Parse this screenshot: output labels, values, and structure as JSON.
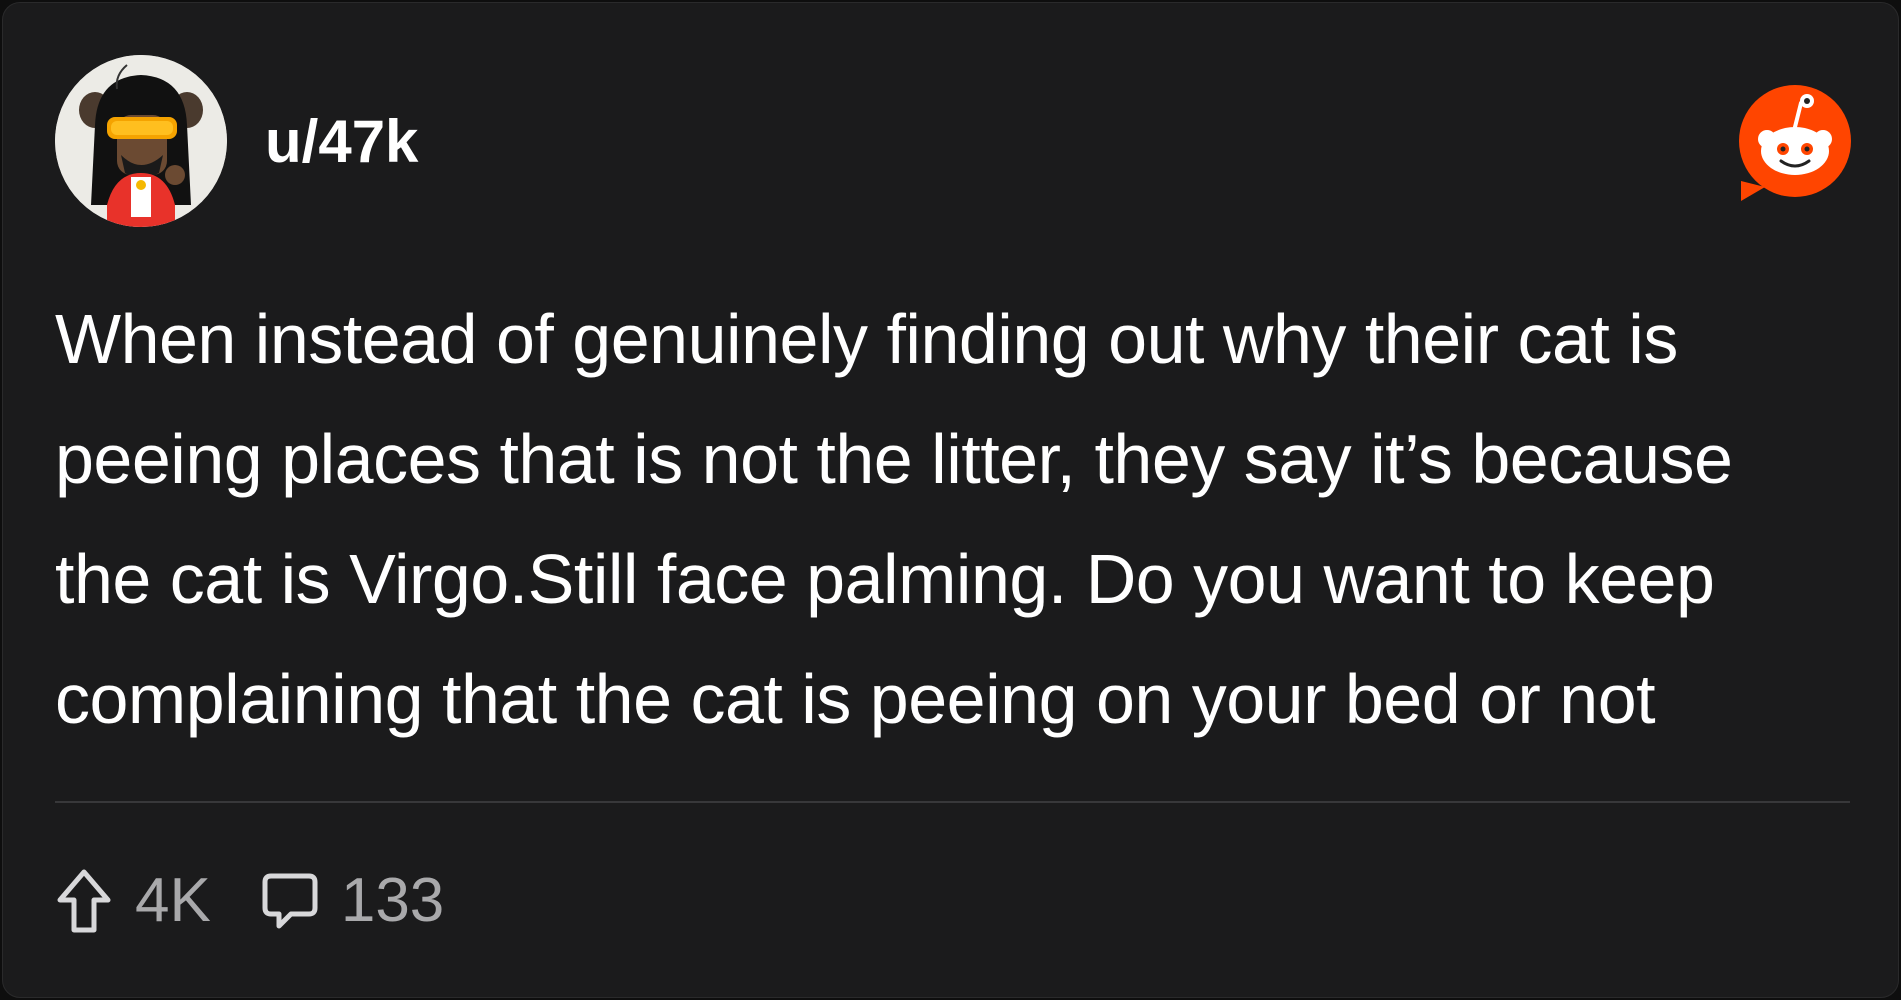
{
  "post": {
    "username": "u/47k",
    "body": "When instead of genuinely finding out why their cat is\npeeing places that is not the litter, they say it’s because\nthe cat is Virgo.Still face palming. Do you want to keep\ncomplaining that the cat is peeing on your bed or not",
    "upvotes": "4K",
    "comments": "133"
  },
  "icons": {
    "avatar": "user-avatar",
    "logo": "reddit-logo-icon",
    "upvote": "upvote-arrow-icon",
    "comment": "comment-bubble-icon"
  },
  "colors": {
    "background": "#1b1b1c",
    "text": "#ffffff",
    "muted": "#a9a9ab",
    "reddit_orange": "#ff4500"
  }
}
